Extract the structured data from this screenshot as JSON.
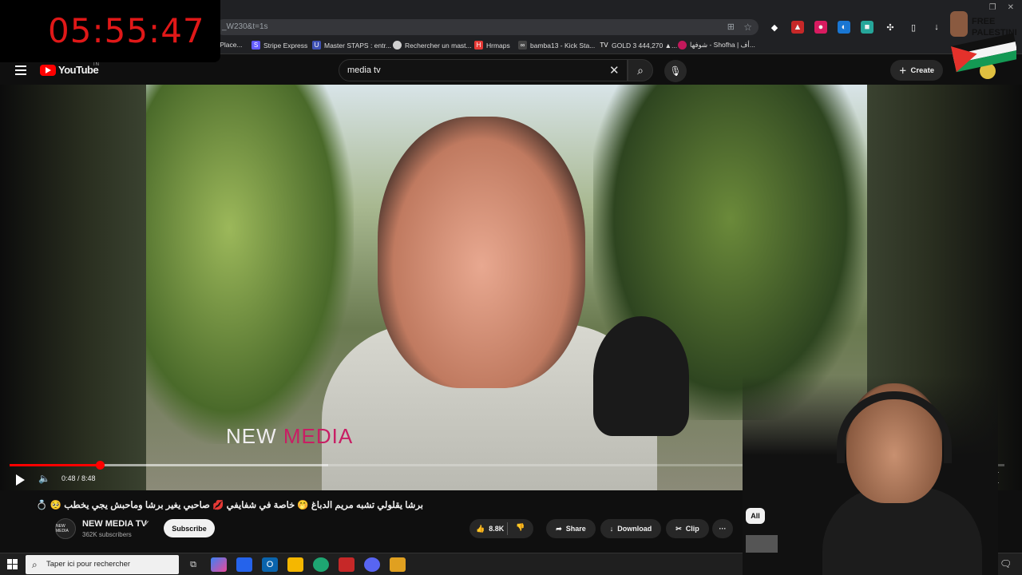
{
  "stream_timer": "05:55:47",
  "browser": {
    "url_fragment": "_W230&t=1s",
    "bookmarks": [
      {
        "label": "r Place...",
        "color": "#555555"
      },
      {
        "label": "Stripe Express",
        "color": "#635bff"
      },
      {
        "label": "Master STAPS : entr...",
        "color": "#3f51b5"
      },
      {
        "label": "Rechercher un mast...",
        "color": "#d0d0d0"
      },
      {
        "label": "Hrmaps",
        "color": "#e53935"
      },
      {
        "label": "bamba13 - Kick Sta...",
        "color": "#888888"
      },
      {
        "label": "GOLD 3 444,270 ▲...",
        "color": "#222222"
      },
      {
        "label": "شوفها - Shofha | أف...",
        "color": "#c2185b"
      }
    ]
  },
  "overlay": {
    "palestine_text_1": "FREE",
    "palestine_text_2": "PALESTINE"
  },
  "youtube": {
    "logo_text": "YouTube",
    "logo_region": "TN",
    "search_value": "media tv",
    "create_label": "Create"
  },
  "video": {
    "watermark_new": "NEW ",
    "watermark_media": "MEDIA",
    "current_time": "0:48",
    "duration": "8:48",
    "time_display": "0:48 / 8:48",
    "progress_fraction": 0.091
  },
  "meta": {
    "title": "برشا يقلولي تشبه مريم الدباغ 🤭 خاصة في شفايفي 💋 صاحبي يغير برشا وماحبش يجي يخطب 🥺 💍",
    "channel_name": "NEW MEDIA TV",
    "channel_avatar_text": "NEW MEDIA",
    "subscribers": "362K subscribers",
    "subscribe_label": "Subscribe",
    "likes": "8.8K",
    "share_label": "Share",
    "download_label": "Download",
    "clip_label": "Clip",
    "more_label": "···",
    "filter_chip": "All"
  },
  "taskbar": {
    "search_placeholder": "Taper ici pour rechercher"
  }
}
